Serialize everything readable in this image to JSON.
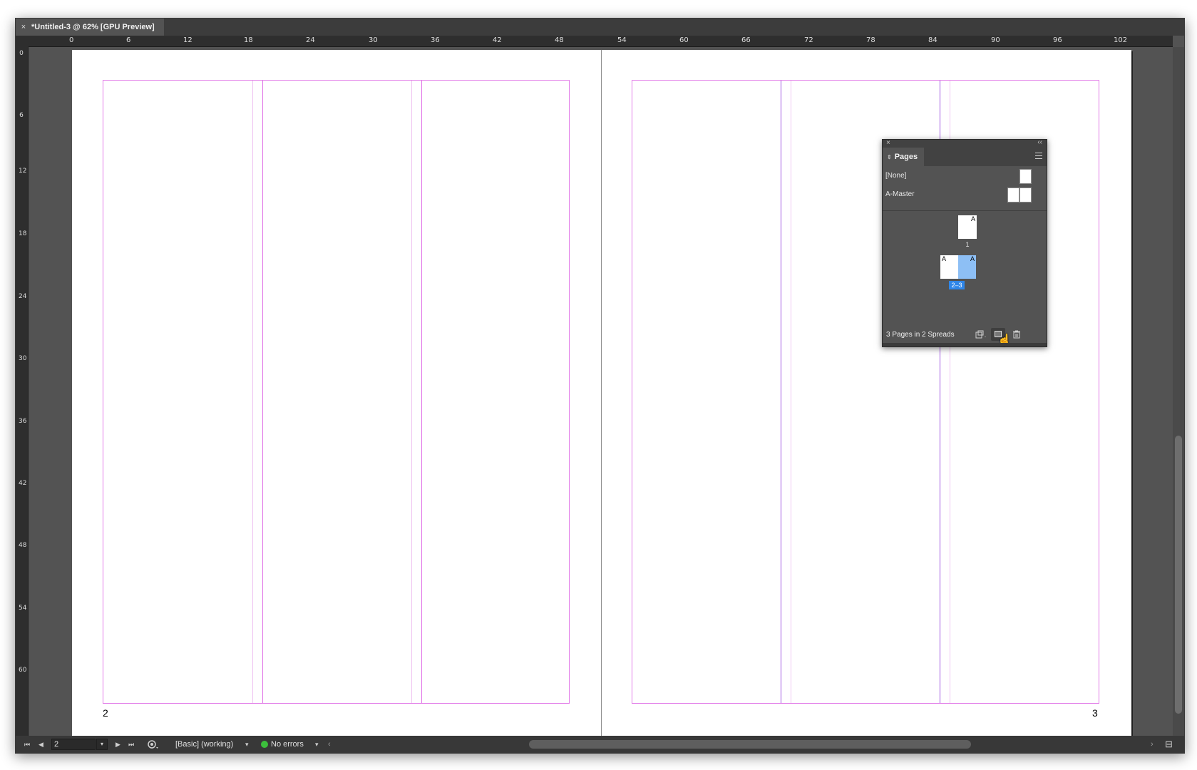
{
  "document_tab": {
    "close": "×",
    "title": "*Untitled-3 @ 62% [GPU Preview]"
  },
  "ruler_h": [
    "0",
    "6",
    "12",
    "18",
    "24",
    "30",
    "36",
    "42",
    "48",
    "54",
    "60",
    "66",
    "72",
    "78",
    "84",
    "90",
    "96",
    "102"
  ],
  "ruler_v": [
    "0",
    "6",
    "12",
    "18",
    "24",
    "30",
    "36",
    "42",
    "48",
    "54",
    "60"
  ],
  "pages": {
    "left_number": "2",
    "right_number": "3"
  },
  "panel": {
    "close": "×",
    "collapse": "‹‹",
    "tab_arrows": "⇕",
    "title": "Pages",
    "masters": [
      "[None]",
      "A-Master"
    ],
    "page1_label": "1",
    "spread_label": "2–3",
    "master_letter": "A",
    "summary": "3 Pages in 2 Spreads",
    "icons": {
      "edit_page_size": "page-size-icon",
      "new_page": "new-page-icon",
      "delete": "trash-icon"
    },
    "selected_color": "#8dbff5",
    "badge_color": "#2f86e8"
  },
  "status": {
    "first": "⏮",
    "prev": "◀",
    "page_value": "2",
    "drop": "▾",
    "next": "▶",
    "last": "⏭",
    "preflight_profile": "[Basic] (working)",
    "profile_drop": "▾",
    "errors": "No errors",
    "errors_drop": "▾",
    "scroll_left": "‹",
    "scroll_right": "›",
    "split": "⊟"
  }
}
